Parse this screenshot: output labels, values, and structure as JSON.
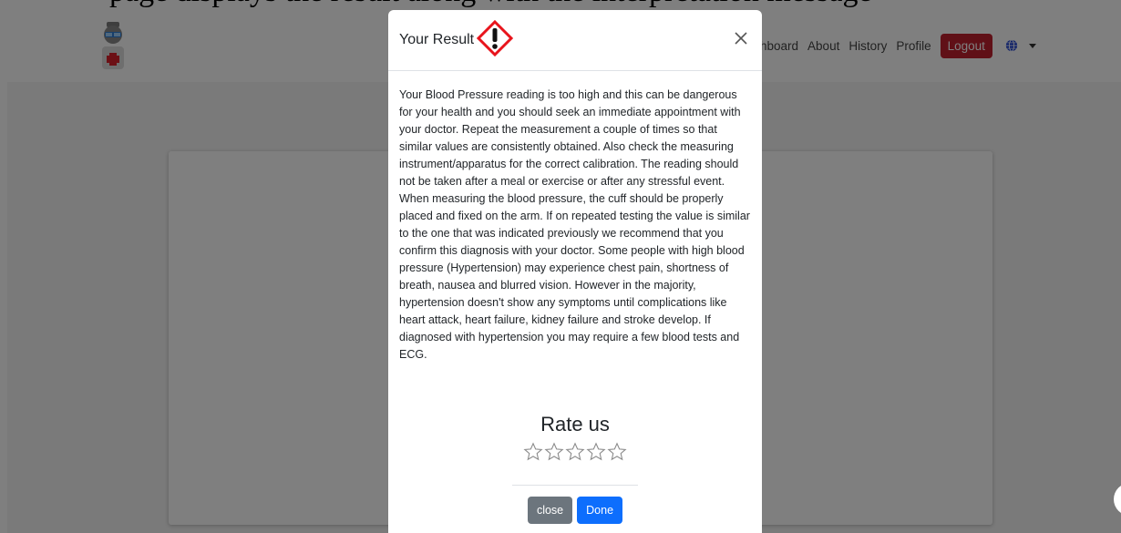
{
  "caption": {
    "text": "page displays the result along with the interpretation message"
  },
  "navbar": {
    "links": [
      "hboard",
      "About",
      "History",
      "Profile"
    ],
    "logout_label": "Logout"
  },
  "modal": {
    "title": "Your Result",
    "body": "Your Blood Pressure reading is too high and this can be dangerous for your health and you should seek an immediate appointment with your doctor. Repeat the measurement a couple of times so that similar values are consistently obtained. Also check the measuring instrument/apparatus for the correct calibration. The reading should not be taken after a meal or exercise or after any stressful event. When measuring the blood pressure, the cuff should be properly placed and fixed on the arm. If on repeated testing the value is similar to the one that was indicated previously we recommend that you confirm this diagnosis with your doctor. Some people with high blood pressure (Hypertension) may experience chest pain, shortness of breath, nausea and blurred vision. However in the majority, hypertension doesn't show any symptoms until complications like heart attack, heart failure, kidney failure and stroke develop. If diagnosed with hypertension you may require a few blood tests and ECG.",
    "rate_title": "Rate us",
    "rating": {
      "value": 0,
      "max": 5
    },
    "close_label": "close",
    "done_label": "Done"
  },
  "colors": {
    "logout": "#c0202f",
    "done_button": "#0d6efd",
    "close_button": "#6c757d",
    "hazard": "#e8141c"
  },
  "icons": [
    "doctor-avatar-icon",
    "globe-icon",
    "caret-down-icon",
    "hazard-warning-icon",
    "close-icon",
    "star-icon"
  ]
}
